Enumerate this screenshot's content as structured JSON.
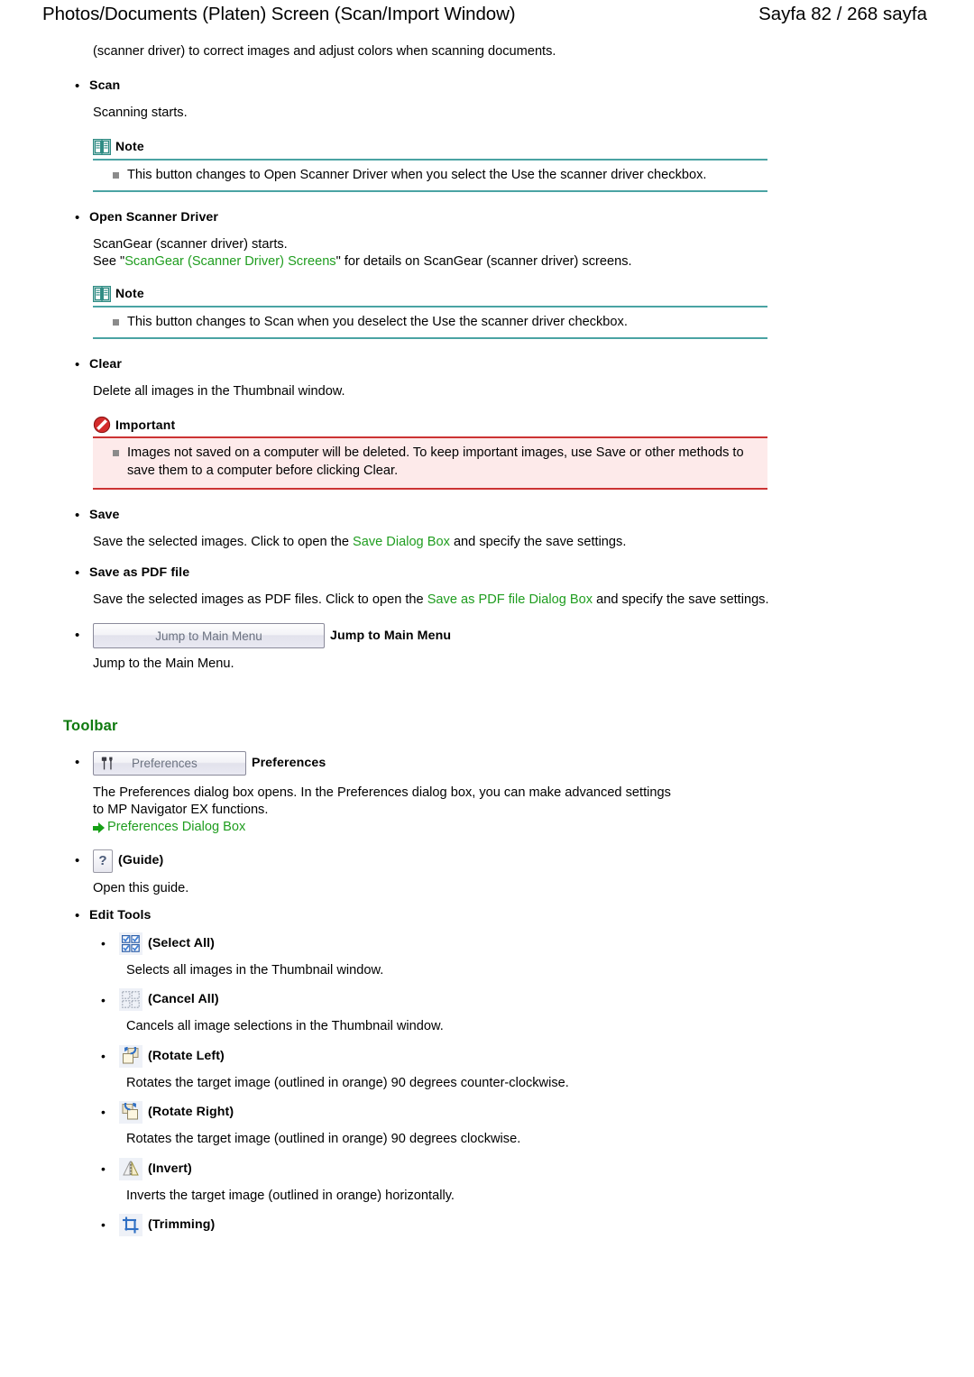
{
  "header": {
    "title": "Photos/Documents (Platen) Screen (Scan/Import Window)",
    "page_indicator": "Sayfa 82 / 268 sayfa"
  },
  "colors": {
    "link_green": "#1f9d1f",
    "section_title_green": "#0f7a0f",
    "note_rule_teal": "#4aa3a3",
    "important_rule_red": "#cc3333",
    "important_bg_pink": "#fdeaea",
    "note_square_bullet": "#8b8b8b",
    "button_text_blue_grey": "#6b7280"
  },
  "intro": {
    "text": "(scanner driver) to correct images and adjust colors when scanning documents."
  },
  "sections": {
    "scan": {
      "label": "Scan",
      "body": "Scanning starts.",
      "note": {
        "title": "Note",
        "items": [
          "This button changes to Open Scanner Driver when you select the Use the scanner driver checkbox."
        ]
      }
    },
    "open_scanner_driver": {
      "label": "Open Scanner Driver",
      "body_line1": "ScanGear (scanner driver) starts.",
      "body_line2_pre": "See \"",
      "body_line2_link": "ScanGear (Scanner Driver) Screens",
      "body_line2_post": "\" for details on ScanGear (scanner driver) screens.",
      "note": {
        "title": "Note",
        "items": [
          "This button changes to Scan when you deselect the Use the scanner driver checkbox."
        ]
      }
    },
    "clear": {
      "label": "Clear",
      "body": "Delete all images in the Thumbnail window.",
      "important": {
        "title": "Important",
        "items": [
          "Images not saved on a computer will be deleted. To keep important images, use Save or other methods to save them to a computer before clicking Clear."
        ]
      }
    },
    "save": {
      "label": "Save",
      "body_pre": "Save the selected images. Click to open the ",
      "body_link": "Save Dialog Box",
      "body_post": " and specify the save settings."
    },
    "save_as_pdf": {
      "label": "Save as PDF file",
      "body_pre": "Save the selected images as PDF files. Click to open the ",
      "body_link": "Save as PDF file Dialog Box",
      "body_post": " and specify the save settings."
    },
    "jump_to_main_menu": {
      "button_label": "Jump to Main Menu",
      "label": "Jump to Main Menu",
      "body": "Jump to the Main Menu."
    }
  },
  "toolbar": {
    "title": "Toolbar",
    "preferences": {
      "button_label": "Preferences",
      "label": "Preferences",
      "body_line1": "The Preferences dialog box opens. In the Preferences dialog box, you can make advanced settings",
      "body_line2": "to MP Navigator EX functions.",
      "link": "Preferences Dialog Box"
    },
    "guide": {
      "button_glyph": "?",
      "label": "(Guide)",
      "body": "Open this guide."
    },
    "edit_tools": {
      "label": "Edit Tools",
      "items": [
        {
          "icon": "select-all-icon",
          "label": "(Select All)",
          "body": "Selects all images in the Thumbnail window."
        },
        {
          "icon": "cancel-all-icon",
          "label": "(Cancel All)",
          "body": "Cancels all image selections in the Thumbnail window."
        },
        {
          "icon": "rotate-left-icon",
          "label": "(Rotate Left)",
          "body": "Rotates the target image (outlined in orange) 90 degrees counter-clockwise."
        },
        {
          "icon": "rotate-right-icon",
          "label": "(Rotate Right)",
          "body": "Rotates the target image (outlined in orange) 90 degrees clockwise."
        },
        {
          "icon": "invert-icon",
          "label": "(Invert)",
          "body": "Inverts the target image (outlined in orange) horizontally."
        },
        {
          "icon": "trimming-icon",
          "label": "(Trimming)",
          "body": ""
        }
      ]
    }
  }
}
